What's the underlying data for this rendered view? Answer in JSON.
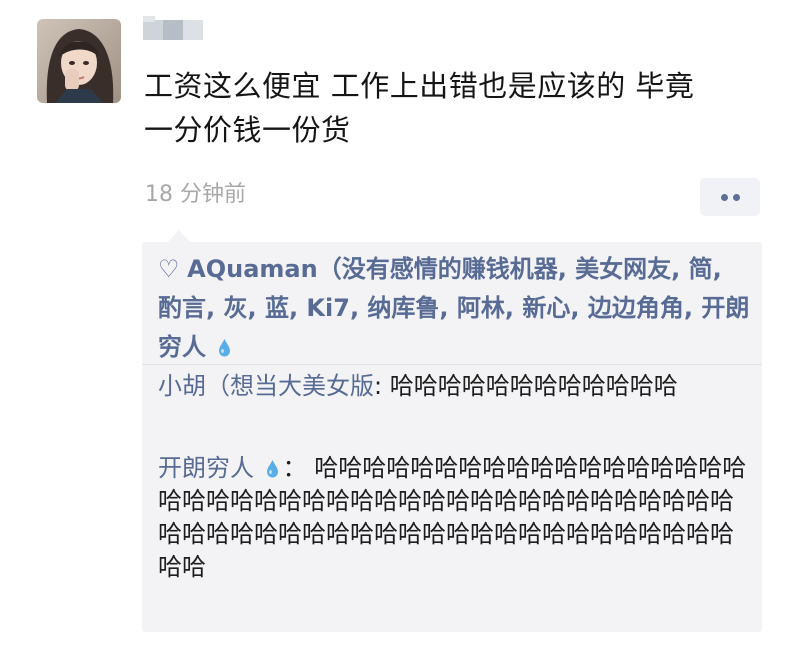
{
  "post": {
    "text_line1": "工资这么便宜 工作上出错也是应该的 毕竟",
    "text_line2": "一分价钱一份货",
    "timestamp": "18 分钟前"
  },
  "likes": {
    "names_before_ki7": "AQuaman（没有感情的赚钱机器, 美女网友, 简, 酌言, 灰, 蓝, ",
    "ki7": "Ki7",
    "names_after_ki7": ", 纳库鲁, 阿林, 新心, 边边角角, 开朗穷人 "
  },
  "comments": [
    {
      "author": "小胡（想当大美女版",
      "separator": ": ",
      "text": "哈哈哈哈哈哈哈哈哈哈哈哈"
    },
    {
      "author": "开朗穷人 ",
      "separator": "： ",
      "text": "哈哈哈哈哈哈哈哈哈哈哈哈哈哈哈哈哈哈哈哈哈哈哈哈哈哈哈哈哈哈哈哈哈哈哈哈哈哈哈哈哈哈哈哈哈哈哈哈哈哈哈哈哈哈哈哈哈哈哈哈哈哈哈哈哈哈哈哈"
    }
  ],
  "icons": {
    "heart": "♡",
    "more": "more-dots-icon",
    "drop": "water-drop-icon"
  },
  "colors": {
    "link": "#576b95",
    "timestamp": "#a8a8a8",
    "panel_bg": "#f3f3f6"
  }
}
